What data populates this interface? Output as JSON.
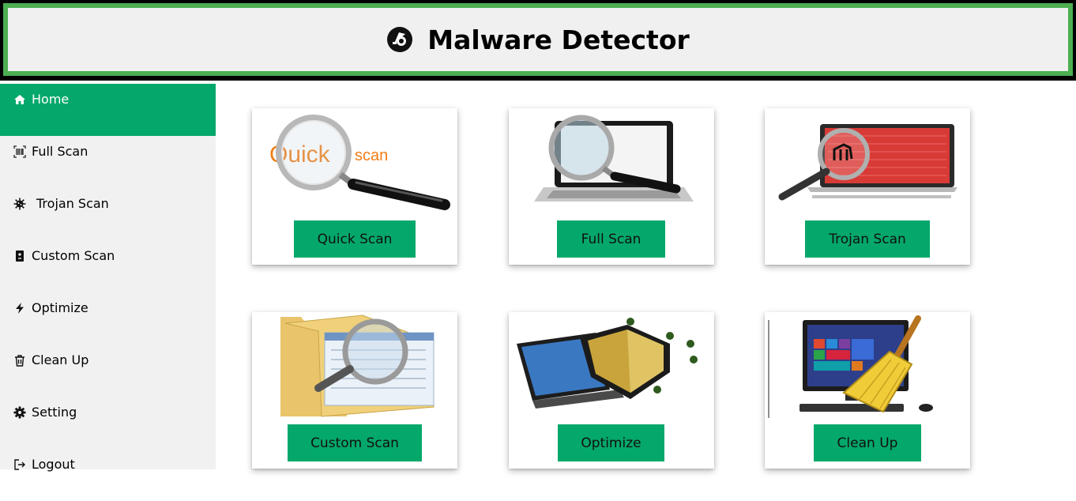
{
  "header": {
    "title": "Malware Detector",
    "logo_icon": "radar-logo-icon"
  },
  "colors": {
    "accent": "#04a86a",
    "header_border": "#4caf50",
    "sidebar_bg": "#f1f1f1"
  },
  "sidebar": {
    "items": [
      {
        "label": "Home",
        "icon": "home-icon",
        "active": true
      },
      {
        "label": "Full Scan",
        "icon": "barcode-scan-icon"
      },
      {
        "label": "Trojan Scan",
        "icon": "virus-icon"
      },
      {
        "label": "Custom Scan",
        "icon": "file-icon"
      },
      {
        "label": "Optimize",
        "icon": "bolt-icon"
      },
      {
        "label": "Clean Up",
        "icon": "trash-icon"
      },
      {
        "label": "Setting",
        "icon": "gear-icon"
      },
      {
        "label": "Logout",
        "icon": "sign-out-icon"
      }
    ]
  },
  "cards": [
    {
      "label": "Quick Scan",
      "image_text_1": "Quick",
      "image_text_2": "scan",
      "image": "magnifier-quick-scan-image"
    },
    {
      "label": "Full Scan",
      "image": "laptop-magnifier-image"
    },
    {
      "label": "Trojan Scan",
      "image": "trojan-laptop-image"
    },
    {
      "label": "Custom Scan",
      "image": "folder-magnifier-image"
    },
    {
      "label": "Optimize",
      "image": "laptop-shield-image"
    },
    {
      "label": "Clean Up",
      "image": "desktop-broom-image"
    }
  ]
}
